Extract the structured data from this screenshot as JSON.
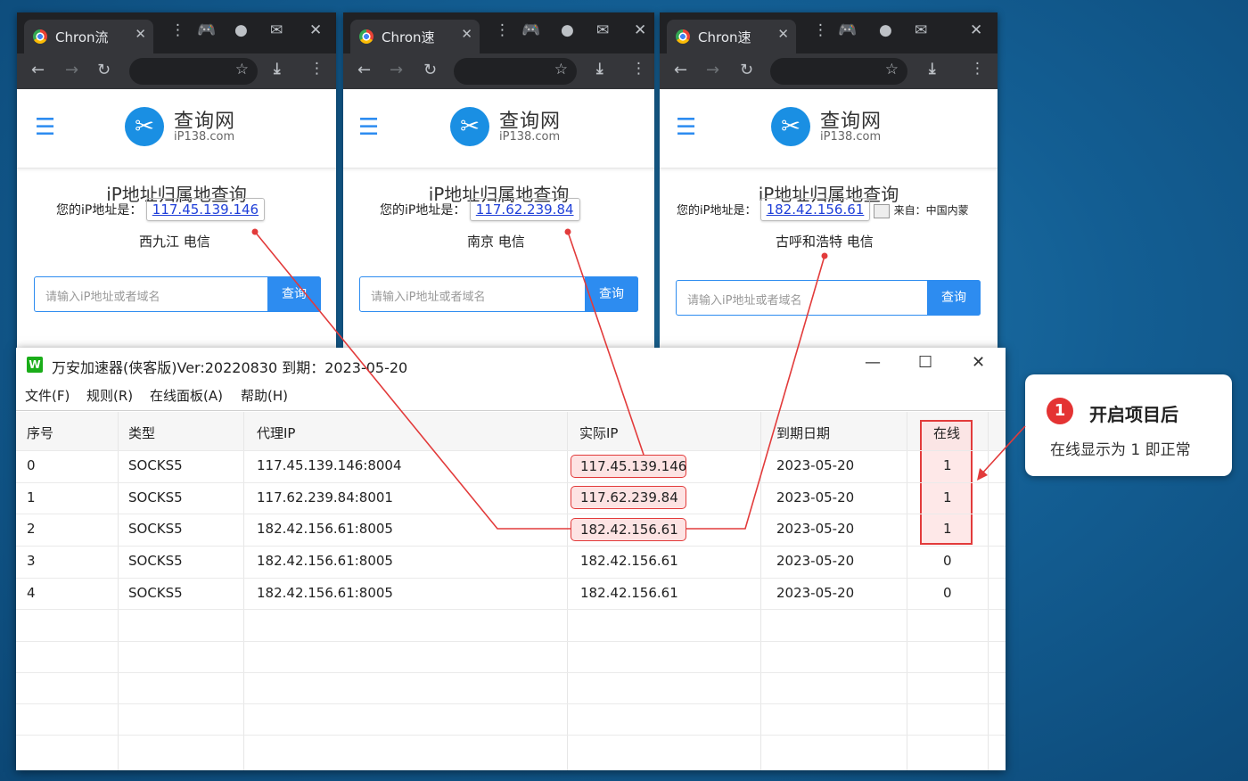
{
  "browsers": [
    {
      "tab_title": "Chron流",
      "site_name": "查询网",
      "site_domain": "iP138.com",
      "page_title": "iP地址归属地查询",
      "ip_label": "您的iP地址是：",
      "ip": "117.45.139.146",
      "location": "西九江 电信",
      "search_placeholder": "请输入iP地址或者域名",
      "search_button": "查询"
    },
    {
      "tab_title": "Chron速",
      "site_name": "查询网",
      "site_domain": "iP138.com",
      "page_title": "iP地址归属地查询",
      "ip_label": "您的iP地址是：",
      "ip": "117.62.239.84",
      "location": "南京 电信",
      "search_placeholder": "请输入iP地址或者域名",
      "search_button": "查询"
    },
    {
      "tab_title": "Chron速",
      "site_name": "查询网",
      "site_domain": "iP138.com",
      "page_title": "iP地址归属地查询",
      "ip_label": "您的iP地址是：",
      "ip": "182.42.156.61",
      "from_label": "来自：中国内蒙",
      "location": "古呼和浩特 电信",
      "search_placeholder": "请输入iP地址或者域名",
      "search_button": "查询"
    }
  ],
  "app": {
    "title": "万安加速器(侠客版)Ver:20220830 到期：2023-05-20",
    "icon_letter": "W",
    "menu": [
      "文件(F)",
      "规则(R)",
      "在线面板(A)",
      "帮助(H)"
    ],
    "columns": [
      "序号",
      "类型",
      "代理IP",
      "实际IP",
      "到期日期",
      "在线"
    ],
    "rows": [
      [
        "0",
        "SOCKS5",
        "117.45.139.146:8004",
        "117.45.139.146",
        "2023-05-20",
        "1"
      ],
      [
        "1",
        "SOCKS5",
        "117.62.239.84:8001",
        "117.62.239.84",
        "2023-05-20",
        "1"
      ],
      [
        "2",
        "SOCKS5",
        "182.42.156.61:8005",
        "182.42.156.61",
        "2023-05-20",
        "1"
      ],
      [
        "3",
        "SOCKS5",
        "182.42.156.61:8005",
        "182.42.156.61",
        "2023-05-20",
        "0"
      ],
      [
        "4",
        "SOCKS5",
        "182.42.156.61:8005",
        "182.42.156.61",
        "2023-05-20",
        "0"
      ]
    ]
  },
  "callout": {
    "number": "1",
    "title": "开启项目后",
    "subtitle": "在线显示为 1 即正常"
  },
  "colors": {
    "accent_blue": "#2d8cf0",
    "annotation_red": "#e23b3b",
    "app_green": "#1aad19"
  },
  "icons": [
    "chrome-logo-icon",
    "close-icon",
    "kebab-icon",
    "gamepad-icon",
    "profile-icon",
    "mail-icon",
    "back-arrow-icon",
    "forward-arrow-icon",
    "reload-icon",
    "star-icon",
    "download-icon",
    "hamburger-icon",
    "wrench-logo-icon",
    "minimize-icon",
    "maximize-icon"
  ]
}
